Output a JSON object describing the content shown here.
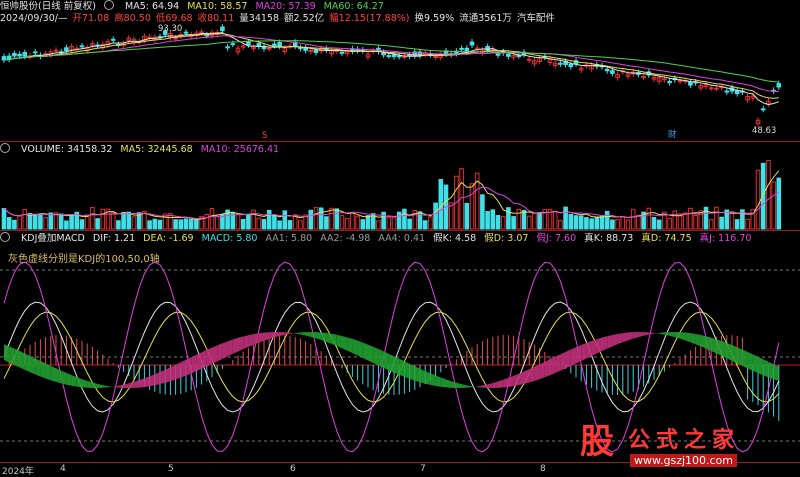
{
  "colors": {
    "bg": "#000000",
    "up": "#e03030",
    "down": "#40e0e8",
    "ma5": "#e6e6e6",
    "ma10": "#e7e050",
    "ma20": "#e040e0",
    "ma60": "#50d050"
  },
  "main": {
    "title_line": {
      "stock": "恒帅股份(日线 前复权)",
      "ma5": "MA5: 64.94",
      "ma10": "MA10: 58.57",
      "ma20": "MA20: 57.39",
      "ma60": "MA60: 64.27"
    },
    "info_line": {
      "date": "2024/09/30/—",
      "open": "开71.08",
      "high": "高80.50",
      "low": "低69.68",
      "close": "收80.11",
      "vol": "量34158",
      "amount": "额2.52亿",
      "change": "幅12.15(17.88%)",
      "turnover": "换9.59%",
      "float": "流通3561万",
      "sector": "汽车配件"
    },
    "price_high_label": "93.30",
    "price_low_label": "48.63",
    "marker_fin": "财",
    "marker_fin2": "财",
    "marker_s": "S"
  },
  "volume": {
    "label": "VOLUME: 34158.32",
    "ma5": "MA5: 32445.68",
    "ma10": "MA10: 25676.41"
  },
  "kdj": {
    "label": "KDJ叠加MACD",
    "dif": "DIF: 1.21",
    "dea": "DEA: -1.69",
    "macd": "MACD: 5.80",
    "aa1": "AA1: 5.80",
    "aa2": "AA2: -4.98",
    "aa4": "AA4: 0.41",
    "fk": "假K: 4.58",
    "fd": "假D: 3.07",
    "fj": "假J: 7.60",
    "tk": "真K: 88.73",
    "td": "真D: 74.75",
    "tj": "真J: 116.70",
    "note": "灰色虚线分别是KDJ的100,50,0轴"
  },
  "axis": {
    "labels": [
      "2024年",
      "4",
      "5",
      "6",
      "7",
      "8"
    ]
  },
  "logo": {
    "gu": "股",
    "name": "公式之家",
    "url": "www.gszj100.com"
  }
}
